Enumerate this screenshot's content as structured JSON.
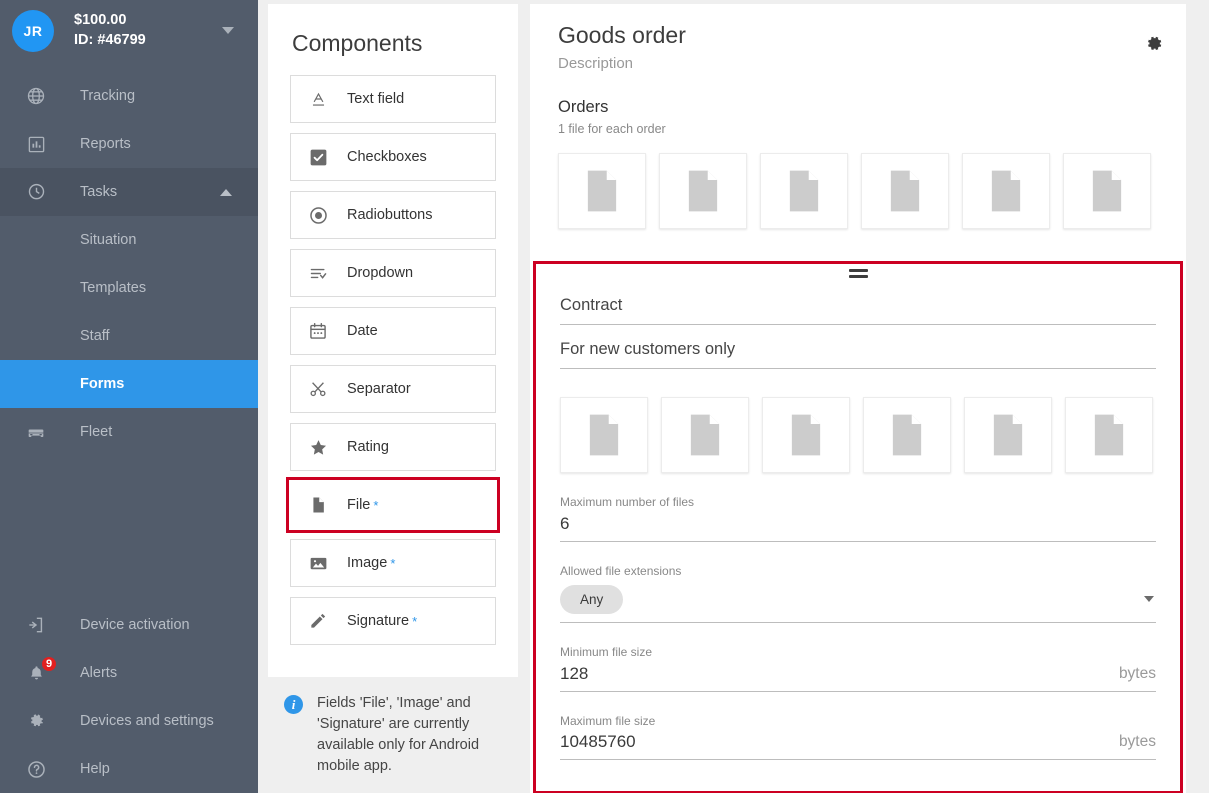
{
  "sidebar": {
    "account": {
      "avatar_initials": "JR",
      "balance": "$100.00",
      "id": "ID: #46799",
      "caret_icon": "chevron-down-icon"
    },
    "items": [
      {
        "label": "Tracking",
        "icon": "globe-icon",
        "type": "top",
        "state": "normal"
      },
      {
        "label": "Reports",
        "icon": "chart-bar-icon",
        "type": "top",
        "state": "normal"
      },
      {
        "label": "Tasks",
        "icon": "clock-icon",
        "type": "top",
        "state": "expanded"
      },
      {
        "label": "Situation",
        "icon": "",
        "type": "sub",
        "state": "normal"
      },
      {
        "label": "Templates",
        "icon": "",
        "type": "sub",
        "state": "normal"
      },
      {
        "label": "Staff",
        "icon": "",
        "type": "sub",
        "state": "normal"
      },
      {
        "label": "Forms",
        "icon": "",
        "type": "sub",
        "state": "active"
      },
      {
        "label": "Fleet",
        "icon": "car-icon",
        "type": "top",
        "state": "normal"
      }
    ],
    "bottom_items": [
      {
        "label": "Device activation",
        "icon": "device-activation-icon",
        "badge": ""
      },
      {
        "label": "Alerts",
        "icon": "bell-icon",
        "badge": "9"
      },
      {
        "label": "Devices and settings",
        "icon": "gear-icon",
        "badge": ""
      },
      {
        "label": "Help",
        "icon": "help-circle-icon",
        "badge": ""
      }
    ],
    "colors": {
      "background": "#525c6b",
      "active": "#2f96e8",
      "expanded": "#4a5361",
      "badge": "#e02020"
    }
  },
  "components_panel": {
    "title": "Components",
    "items": [
      {
        "label": "Text field",
        "icon": "text-field-icon",
        "required_star": false,
        "selected": false
      },
      {
        "label": "Checkboxes",
        "icon": "checkbox-icon",
        "required_star": false,
        "selected": false
      },
      {
        "label": "Radiobuttons",
        "icon": "radio-button-icon",
        "required_star": false,
        "selected": false
      },
      {
        "label": "Dropdown",
        "icon": "dropdown-icon",
        "required_star": false,
        "selected": false
      },
      {
        "label": "Date",
        "icon": "calendar-icon",
        "required_star": false,
        "selected": false
      },
      {
        "label": "Separator",
        "icon": "scissors-icon",
        "required_star": false,
        "selected": false
      },
      {
        "label": "Rating",
        "icon": "star-icon",
        "required_star": false,
        "selected": false
      },
      {
        "label": "File",
        "icon": "file-icon",
        "required_star": true,
        "selected": true
      },
      {
        "label": "Image",
        "icon": "image-icon",
        "required_star": true,
        "selected": false
      },
      {
        "label": "Signature",
        "icon": "pencil-icon",
        "required_star": true,
        "selected": false
      }
    ],
    "star_symbol": "*",
    "note": {
      "icon": "info-icon",
      "text": "Fields 'File', 'Image' and 'Signature' are currently available only for Android mobile app."
    },
    "selection_color": "#cc0022"
  },
  "form": {
    "title": "Goods order",
    "description": "Description",
    "settings_icon": "gear-icon",
    "orders_section": {
      "title": "Orders",
      "subtitle": "1 file for each order",
      "thumbnail_count": 6,
      "thumbnail_icon": "file-placeholder-icon"
    },
    "selected_block": {
      "drag_handle_icon": "drag-handle-icon",
      "title_value": "Contract",
      "subtitle_value": "For new customers only",
      "thumbnail_count": 6,
      "thumbnail_icon": "file-placeholder-icon",
      "fields": [
        {
          "label": "Maximum number of files",
          "value": "6",
          "unit": ""
        },
        {
          "label": "Minimum file size",
          "value": "128",
          "unit": "bytes"
        },
        {
          "label": "Maximum file size",
          "value": "10485760",
          "unit": "bytes"
        }
      ],
      "extensions_field": {
        "label": "Allowed file extensions",
        "chip": "Any",
        "caret_icon": "chevron-down-icon"
      }
    }
  }
}
